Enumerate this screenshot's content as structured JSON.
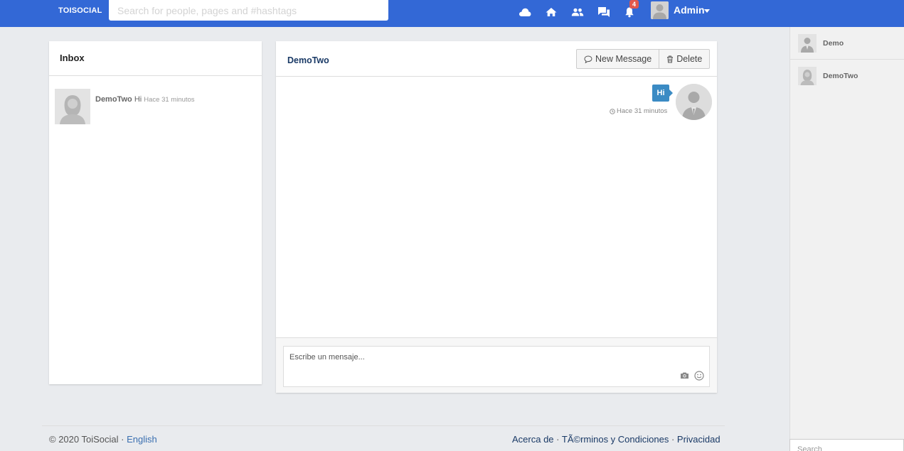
{
  "header": {
    "brand": "TOISOCIAL",
    "search_placeholder": "Search for people, pages and #hashtags",
    "notification_count": "4",
    "user_name": "Admin",
    "icons": [
      "cloud-icon",
      "home-icon",
      "friends-icon",
      "messages-icon",
      "bell-icon"
    ]
  },
  "inbox": {
    "title": "Inbox",
    "items": [
      {
        "name": "DemoTwo",
        "message": "Hi",
        "time": "Hace 31 minutos"
      }
    ]
  },
  "chat": {
    "title": "DemoTwo",
    "new_message_label": "New Message",
    "delete_label": "Delete",
    "messages": [
      {
        "text": "Hi",
        "time": "Hace 31 minutos"
      }
    ],
    "compose_placeholder": "Escribe un mensaje..."
  },
  "footer": {
    "copyright": "© 2020 ToiSocial · ",
    "language": "English",
    "about": "Acerca de",
    "terms": "TÃ©rminos y Condiciones",
    "privacy": "Privacidad",
    "separator": " · "
  },
  "sidebar": {
    "contacts": [
      {
        "name": "Demo"
      },
      {
        "name": "DemoTwo"
      }
    ],
    "search_placeholder": "Search"
  },
  "colors": {
    "topbar": "#3368d6",
    "bubble": "#3b8bc4",
    "badge": "#e2584c",
    "background": "#e9ebee"
  }
}
